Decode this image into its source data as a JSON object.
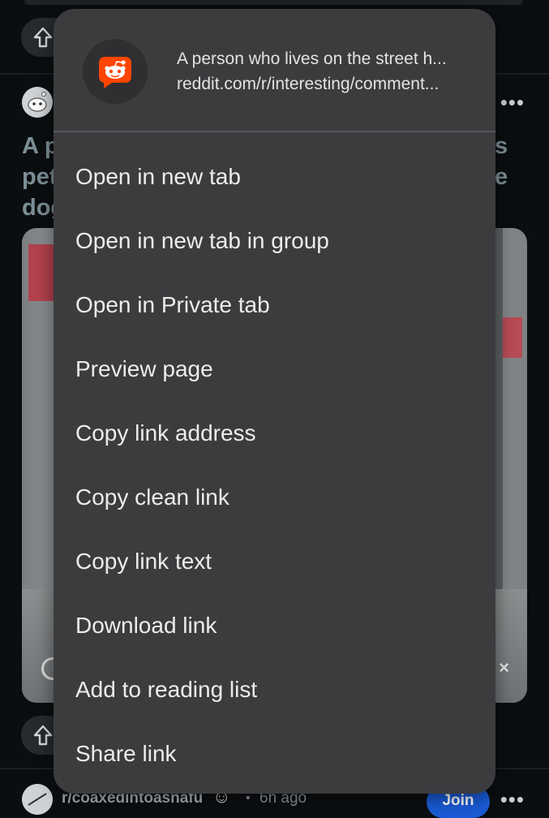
{
  "feed": {
    "post_title_fragments": [
      "A p",
      "pet",
      "dog",
      "s",
      "e"
    ],
    "next_post": {
      "subreddit": "r/coaxedintoasnafu",
      "separator": "•",
      "time": "6h ago",
      "join_label": "Join"
    },
    "more_icon": "•••",
    "close_icon": "×"
  },
  "menu": {
    "favicon": "reddit-icon",
    "title": "A person who lives on the street h...",
    "url": "reddit.com/r/interesting/comment...",
    "items": [
      "Open in new tab",
      "Open in new tab in group",
      "Open in Private tab",
      "Preview page",
      "Copy link address",
      "Copy clean link",
      "Copy link text",
      "Download link",
      "Add to reading list",
      "Share link"
    ]
  },
  "colors": {
    "menu_bg": "#3c3c3f",
    "reddit_orange": "#ff4500",
    "join_blue": "#1a5bd6"
  }
}
